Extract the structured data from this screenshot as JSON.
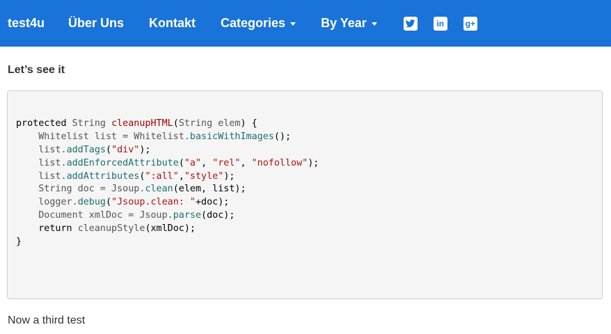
{
  "navbar": {
    "brand": "test4u",
    "items": [
      {
        "label": "Über Uns"
      },
      {
        "label": "Kontakt"
      },
      {
        "label": "Categories"
      },
      {
        "label": "By Year"
      }
    ],
    "social": [
      {
        "icon": "twitter-icon"
      },
      {
        "icon": "linkedin-icon",
        "text": "in"
      },
      {
        "icon": "google-plus-icon",
        "text": "g+"
      }
    ],
    "colors": {
      "background": "#1a73d9",
      "text": "#ffffff"
    }
  },
  "main": {
    "heading": "Let’s see it",
    "code": [
      [
        {
          "t": "protected ",
          "c": "kw"
        },
        {
          "t": "String ",
          "c": "ty"
        },
        {
          "t": "cleanupHTML",
          "c": "fn"
        },
        {
          "t": "(",
          "c": "kw"
        },
        {
          "t": "String elem",
          "c": "ty"
        },
        {
          "t": ") {",
          "c": "kw"
        }
      ],
      [
        {
          "t": "    Whitelist list = Whitelist.",
          "c": "ty"
        },
        {
          "t": "basicWithImages",
          "c": "mt"
        },
        {
          "t": "();",
          "c": "kw"
        }
      ],
      [
        {
          "t": "    list.",
          "c": "ty"
        },
        {
          "t": "addTags",
          "c": "mt"
        },
        {
          "t": "(",
          "c": "kw"
        },
        {
          "t": "\"div\"",
          "c": "st"
        },
        {
          "t": ");",
          "c": "kw"
        }
      ],
      [
        {
          "t": "    list.",
          "c": "ty"
        },
        {
          "t": "addEnforcedAttribute",
          "c": "mt"
        },
        {
          "t": "(",
          "c": "kw"
        },
        {
          "t": "\"a\"",
          "c": "st"
        },
        {
          "t": ", ",
          "c": "kw"
        },
        {
          "t": "\"rel\"",
          "c": "st"
        },
        {
          "t": ", ",
          "c": "kw"
        },
        {
          "t": "\"nofollow\"",
          "c": "st"
        },
        {
          "t": ");",
          "c": "kw"
        }
      ],
      [
        {
          "t": "    list.",
          "c": "ty"
        },
        {
          "t": "addAttributes",
          "c": "mt"
        },
        {
          "t": "(",
          "c": "kw"
        },
        {
          "t": "\":all\"",
          "c": "st"
        },
        {
          "t": ",",
          "c": "kw"
        },
        {
          "t": "\"style\"",
          "c": "st"
        },
        {
          "t": ");",
          "c": "kw"
        }
      ],
      [
        {
          "t": "    String doc = Jsoup.",
          "c": "ty"
        },
        {
          "t": "clean",
          "c": "mt"
        },
        {
          "t": "(elem, list);",
          "c": "kw"
        }
      ],
      [
        {
          "t": "    logger.",
          "c": "ty"
        },
        {
          "t": "debug",
          "c": "mt"
        },
        {
          "t": "(",
          "c": "kw"
        },
        {
          "t": "\"Jsoup.clean: \"",
          "c": "st"
        },
        {
          "t": "+doc);",
          "c": "kw"
        }
      ],
      [
        {
          "t": "    Document xmlDoc = Jsoup.",
          "c": "ty"
        },
        {
          "t": "parse",
          "c": "mt"
        },
        {
          "t": "(doc);",
          "c": "kw"
        }
      ],
      [
        {
          "t": "    return ",
          "c": "kw"
        },
        {
          "t": "cleanupStyle",
          "c": "ty"
        },
        {
          "t": "(xmlDoc);",
          "c": "kw"
        }
      ],
      [
        {
          "t": "}",
          "c": "kw"
        }
      ]
    ],
    "next_heading": "Now a third test"
  }
}
